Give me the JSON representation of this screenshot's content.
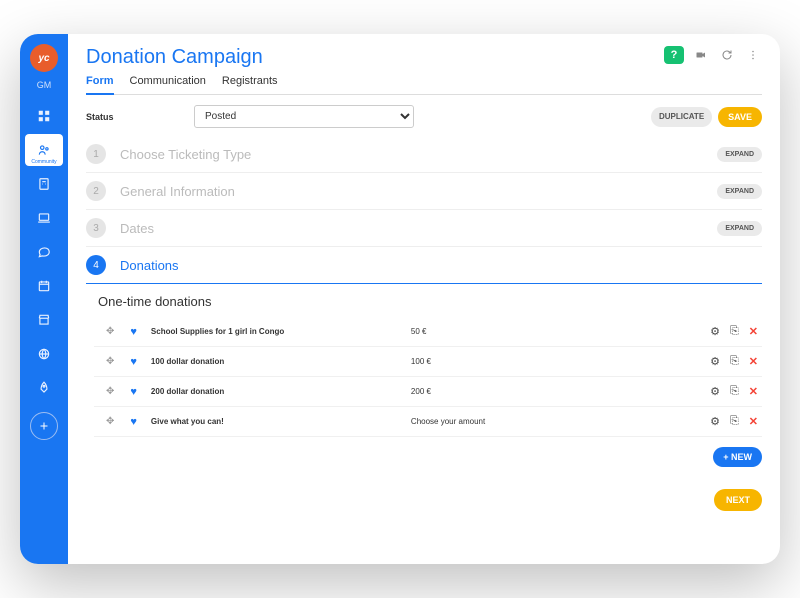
{
  "logo": "yc",
  "user_initials": "GM",
  "sidebar_items": [
    "",
    "Community",
    "",
    "",
    "",
    "",
    "",
    "",
    ""
  ],
  "header": {
    "title": "Donation Campaign",
    "help": "?",
    "tabs": [
      "Form",
      "Communication",
      "Registrants"
    ]
  },
  "status": {
    "label": "Status",
    "value": "Posted",
    "duplicate": "DUPLICATE",
    "save": "SAVE"
  },
  "sections": [
    {
      "num": "1",
      "title": "Choose Ticketing Type",
      "expand": "EXPAND"
    },
    {
      "num": "2",
      "title": "General Information",
      "expand": "EXPAND"
    },
    {
      "num": "3",
      "title": "Dates",
      "expand": "EXPAND"
    },
    {
      "num": "4",
      "title": "Donations"
    }
  ],
  "donations": {
    "heading": "One-time donations",
    "rows": [
      {
        "name": "School Supplies for 1 girl in Congo",
        "amount": "50 €"
      },
      {
        "name": "100 dollar donation",
        "amount": "100 €"
      },
      {
        "name": "200 dollar donation",
        "amount": "200 €"
      },
      {
        "name": "Give what you can!",
        "amount": "Choose your amount"
      }
    ],
    "new": "+ NEW"
  },
  "next": "NEXT"
}
